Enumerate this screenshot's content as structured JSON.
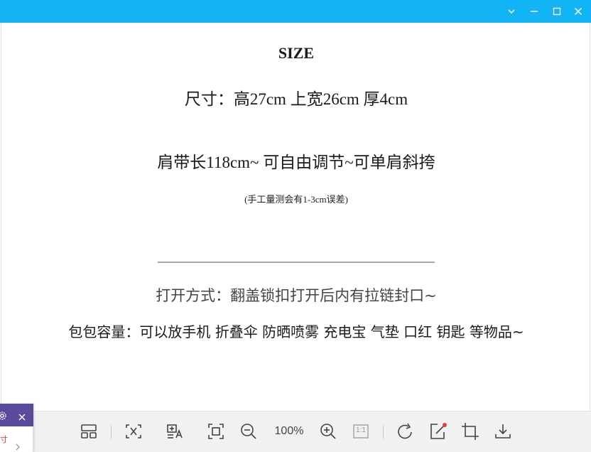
{
  "window": {
    "controls": [
      "chevron-down-icon",
      "minimize-icon",
      "maximize-icon",
      "close-icon"
    ],
    "accent": "#12b4f5"
  },
  "content": {
    "title": "SIZE",
    "size_line": "尺寸：高27cm  上宽26cm   厚4cm",
    "strap_line": "肩带长118cm~ 可自由调节~可单肩斜挎",
    "note_line": "(手工量测会有1-3cm误差)",
    "divider_line": "_______________________________________",
    "open_line": "打开方式：翻盖锁扣打开后内有拉链封口~",
    "capacity_line": "包包容量：可以放手机 折叠伞  防晒喷雾 充电宝 气垫 口红 钥匙 等物品~"
  },
  "toolbar": {
    "zoom_level": "100%",
    "actual_size_label": "1:1",
    "buttons": [
      "layout-grid-icon",
      "fit-selection-icon",
      "ocr-text-icon",
      "fit-screen-icon",
      "zoom-out-icon",
      "zoom-in-icon",
      "actual-size-icon",
      "rotate-icon",
      "edit-icon",
      "crop-icon",
      "download-icon"
    ]
  },
  "side_panel": {
    "text_fragment": "寸",
    "header_color": "#5b4a9c",
    "accent_text_color": "#d33a2c"
  }
}
